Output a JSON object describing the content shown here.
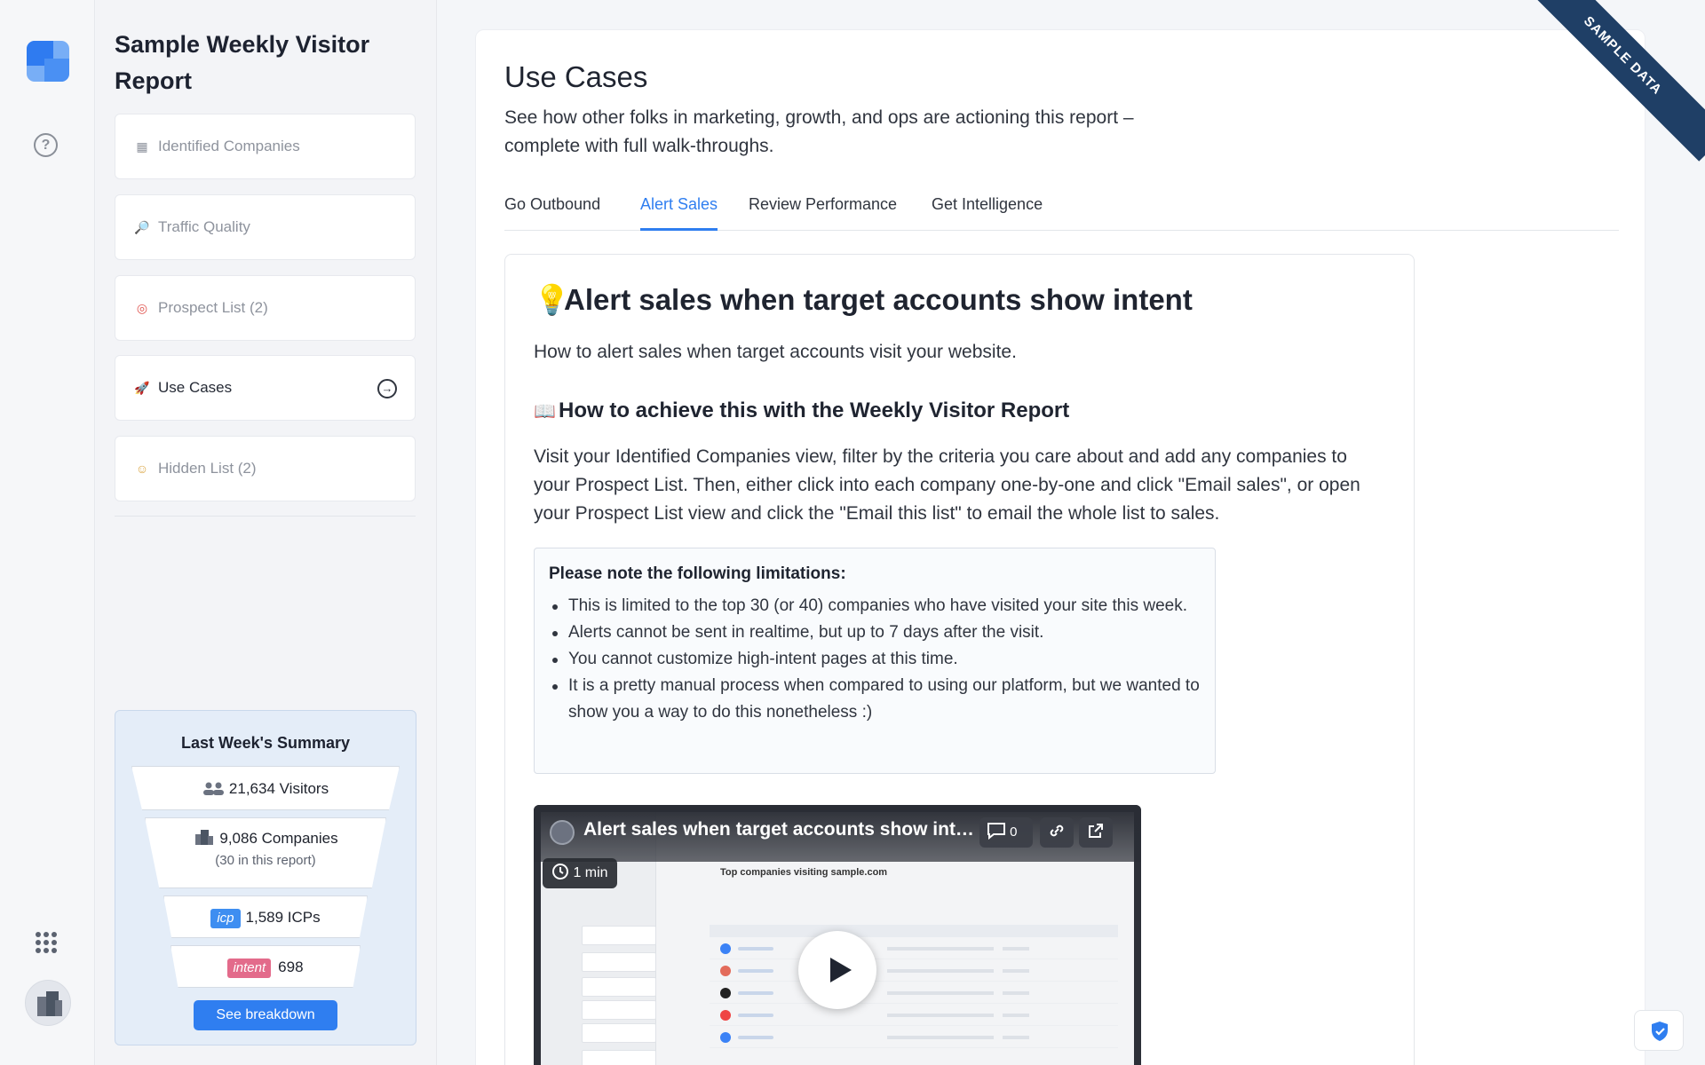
{
  "sidebar": {
    "report_title": "Sample Weekly Visitor Report",
    "nav": [
      {
        "label": "Identified Companies",
        "icon": "building-icon",
        "glyph": "▦"
      },
      {
        "label": "Traffic Quality",
        "icon": "magnifier-icon",
        "glyph": "🔎"
      },
      {
        "label": "Prospect List (2)",
        "icon": "target-icon",
        "glyph": "◎"
      },
      {
        "label": "Use Cases",
        "icon": "rocket-icon",
        "glyph": "🚀"
      },
      {
        "label": "Hidden List (2)",
        "icon": "ghost-icon",
        "glyph": "☺"
      }
    ],
    "active_arrow": "→",
    "summary": {
      "title": "Last Week's Summary",
      "visitors": "21,634 Visitors",
      "companies": "9,086 Companies",
      "companies_sub": "(30 in this report)",
      "icp_badge": "icp",
      "icps": "1,589 ICPs",
      "intent_badge": "intent",
      "intent_count": "698",
      "button": "See breakdown"
    }
  },
  "main": {
    "title": "Use Cases",
    "lede": "See how other folks in marketing, growth, and ops are actioning this report – complete with full walk-throughs.",
    "tabs": [
      "Go Outbound",
      "Alert Sales",
      "Review Performance",
      "Get Intelligence"
    ],
    "active_tab": "Alert Sales"
  },
  "use_case": {
    "bulb": "💡",
    "title": "Alert sales when target accounts show intent",
    "description": "How to alert sales when target accounts visit your website.",
    "book": "📖",
    "subheading": "How to achieve this with the Weekly Visitor Report",
    "body": "Visit your Identified Companies view, filter by the criteria you care about and add any companies to your Prospect List. Then, either click into each company one-by-one and click \"Email sales\", or open your Prospect List view and click the \"Email this list\" to email the whole list to sales.",
    "note_title": "Please note the following limitations:",
    "limitations": [
      "This is limited to the top 30 (or 40) companies who have visited your site this week.",
      "Alerts cannot be sent in realtime, but up to 7 days after the visit.",
      "You cannot customize high-intent pages at this time.",
      "It is a pretty manual process when compared to using our platform, but we wanted to show you a way to do this nonetheless :)"
    ]
  },
  "video": {
    "title": "Alert sales when target accounts show int…",
    "comments": "0",
    "duration": "1 min",
    "thumb_heading": "Top companies visiting sample.com"
  },
  "ribbon": "SAMPLE DATA"
}
